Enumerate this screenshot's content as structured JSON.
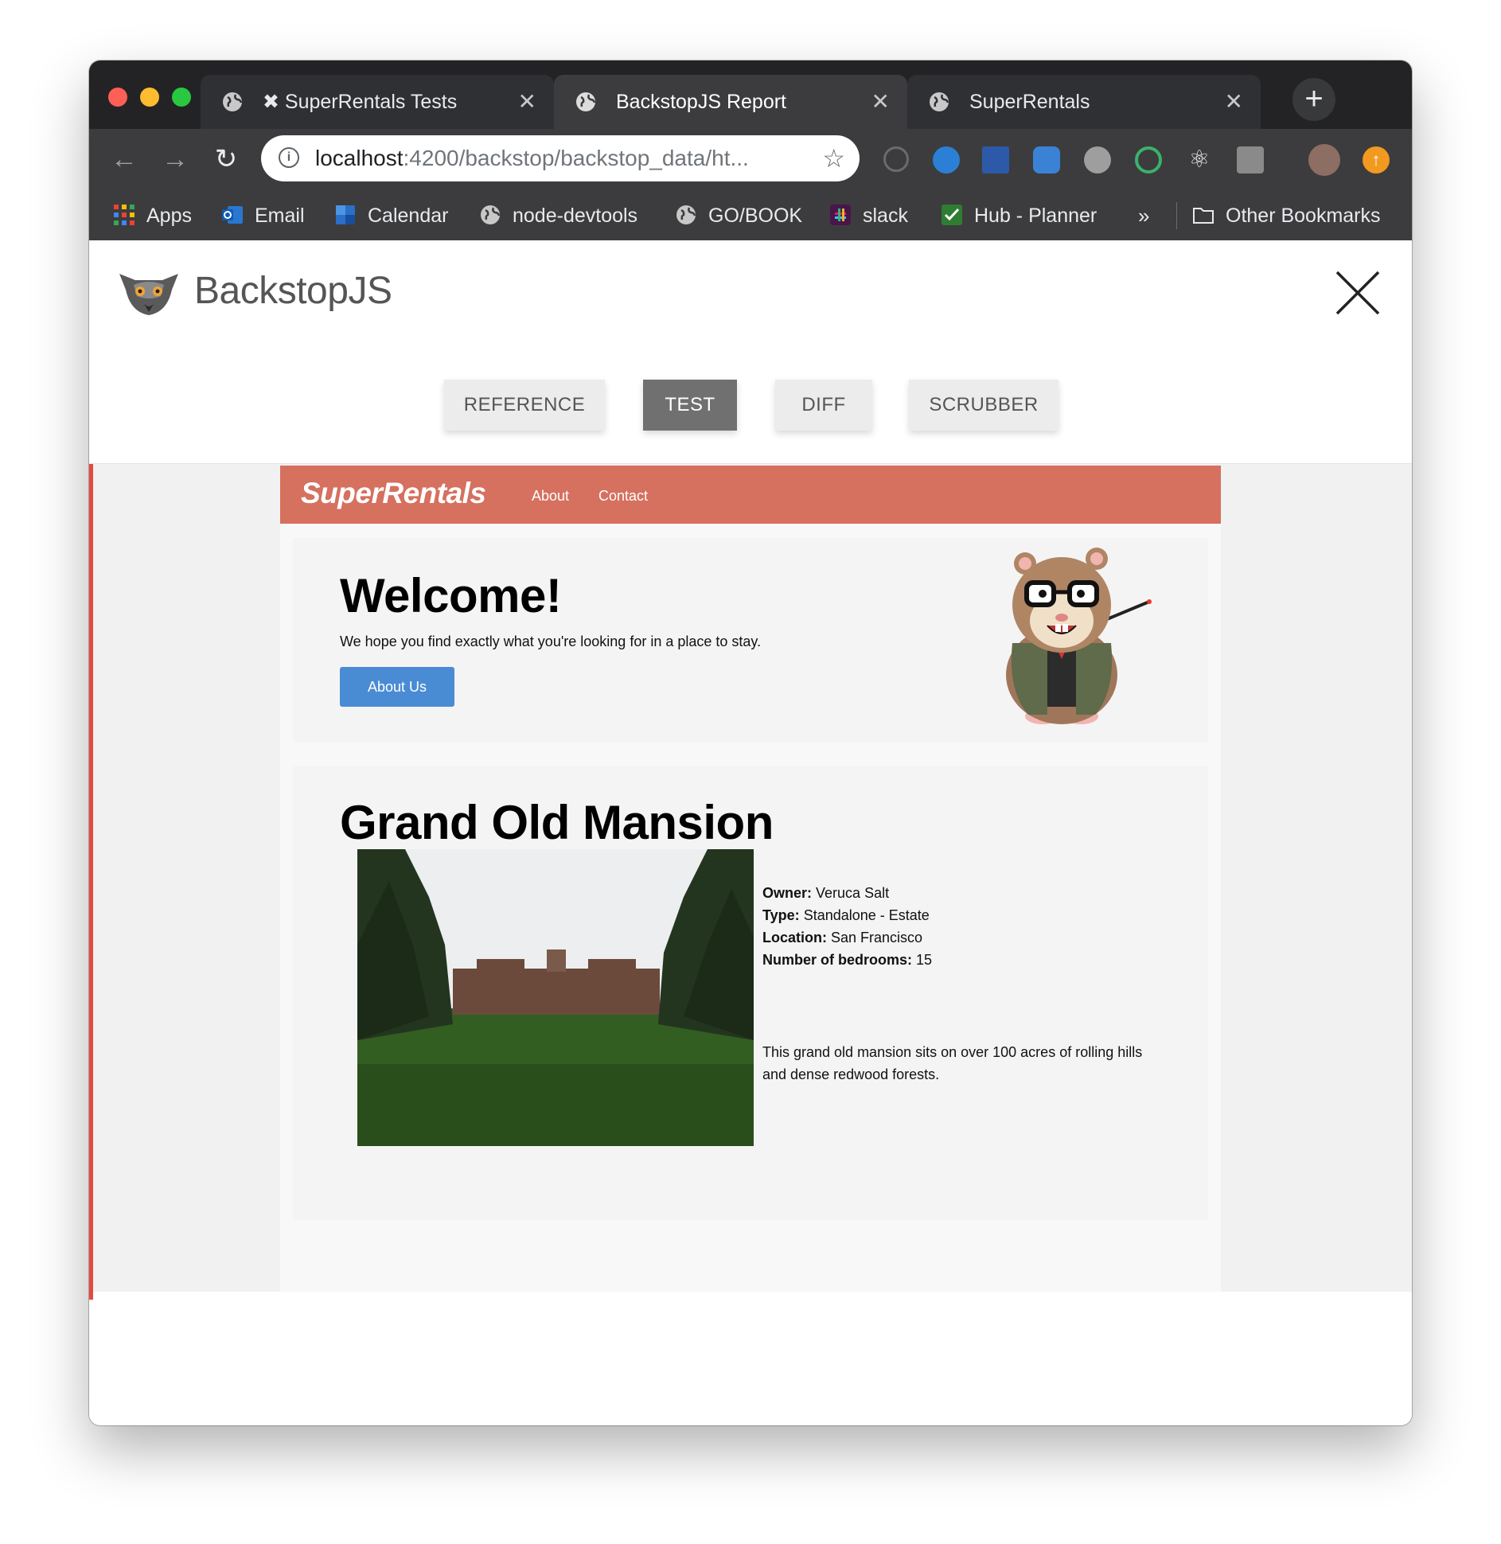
{
  "browser": {
    "tabs": [
      {
        "title": "✖ SuperRentals Tests",
        "active": false
      },
      {
        "title": "BackstopJS Report",
        "active": true
      },
      {
        "title": "SuperRentals",
        "active": false
      }
    ],
    "new_tab_glyph": "+",
    "tab_close_glyph": "✕",
    "url_host": "localhost",
    "url_path": ":4200/backstop/backstop_data/ht...",
    "bookmarks": [
      {
        "label": "Apps",
        "icon": "apps-grid-icon"
      },
      {
        "label": "Email",
        "icon": "outlook-icon"
      },
      {
        "label": "Calendar",
        "icon": "calendar-icon"
      },
      {
        "label": "node-devtools",
        "icon": "globe-icon"
      },
      {
        "label": "GO/BOOK",
        "icon": "globe-icon"
      },
      {
        "label": "slack",
        "icon": "slack-icon"
      },
      {
        "label": "Hub - Planner",
        "icon": "hub-planner-icon"
      }
    ],
    "bookmarks_overflow": "»",
    "other_bookmarks": "Other Bookmarks"
  },
  "backstop": {
    "title": "BackstopJS",
    "modes": [
      {
        "label": "REFERENCE",
        "active": false
      },
      {
        "label": "TEST",
        "active": true
      },
      {
        "label": "DIFF",
        "active": false
      },
      {
        "label": "SCRUBBER",
        "active": false
      }
    ]
  },
  "site": {
    "brand": "SuperRentals",
    "nav_links": [
      "About",
      "Contact"
    ],
    "welcome": {
      "heading": "Welcome!",
      "text": "We hope you find exactly what you're looking for in a place to stay.",
      "button": "About Us"
    },
    "rental": {
      "title": "Grand Old Mansion",
      "details": [
        {
          "label": "Owner:",
          "value": "Veruca Salt"
        },
        {
          "label": "Type:",
          "value": "Standalone - Estate"
        },
        {
          "label": "Location:",
          "value": "San Francisco"
        },
        {
          "label": "Number of bedrooms:",
          "value": "15"
        }
      ],
      "description": "This grand old mansion sits on over 100 acres of rolling hills and dense redwood forests."
    }
  },
  "colors": {
    "accent_nav": "#d6705f",
    "button_blue": "#4a8cd4",
    "active_mode": "#707070",
    "failure_bar": "#e34b3e"
  }
}
